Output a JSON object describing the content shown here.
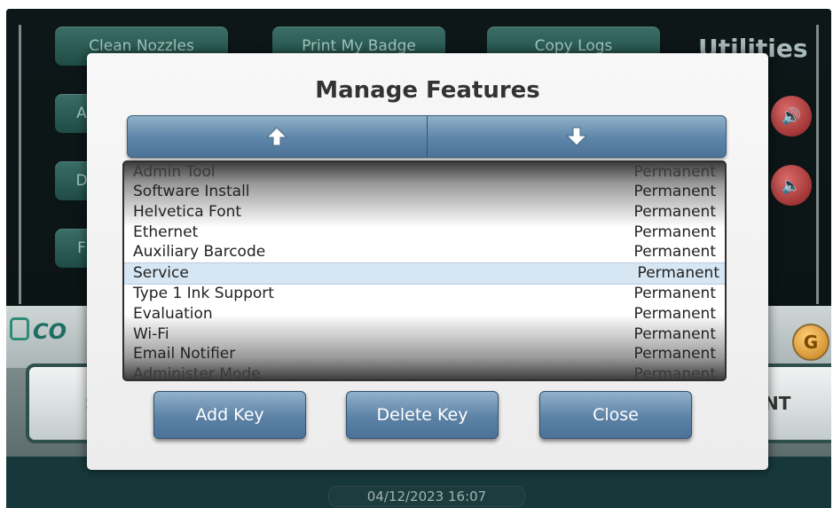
{
  "background": {
    "buttons": [
      "Clean Nozzles",
      "Print My Badge",
      "Copy Logs"
    ],
    "partial_left_buttons": [
      "A",
      "D",
      "F"
    ],
    "section_title": "Utilities",
    "logo_text": "CO",
    "side_left_label": "SY",
    "side_right_label": "NT",
    "orange_icon": "G",
    "datetime": "04/12/2023 16:07"
  },
  "dialog": {
    "title": "Manage Features",
    "scroll_up_icon": "arrow-up-icon",
    "scroll_down_icon": "arrow-down-icon",
    "features": [
      {
        "name": "Admin Tool",
        "status": "Permanent"
      },
      {
        "name": "Software Install",
        "status": "Permanent"
      },
      {
        "name": "Helvetica Font",
        "status": "Permanent"
      },
      {
        "name": "Ethernet",
        "status": "Permanent"
      },
      {
        "name": "Auxiliary Barcode",
        "status": "Permanent"
      },
      {
        "name": "Service",
        "status": "Permanent",
        "selected": true
      },
      {
        "name": "Type 1 Ink Support",
        "status": "Permanent"
      },
      {
        "name": "Evaluation",
        "status": "Permanent"
      },
      {
        "name": "Wi-Fi",
        "status": "Permanent"
      },
      {
        "name": "Email Notifier",
        "status": "Permanent"
      },
      {
        "name": "Administer Mode",
        "status": "Permanent"
      }
    ],
    "buttons": {
      "add_key": "Add Key",
      "delete_key": "Delete Key",
      "close": "Close"
    }
  },
  "colors": {
    "dialog_button": "#5c82a6",
    "selected_row": "#d2e4f2",
    "background_button": "#2c5c55"
  }
}
